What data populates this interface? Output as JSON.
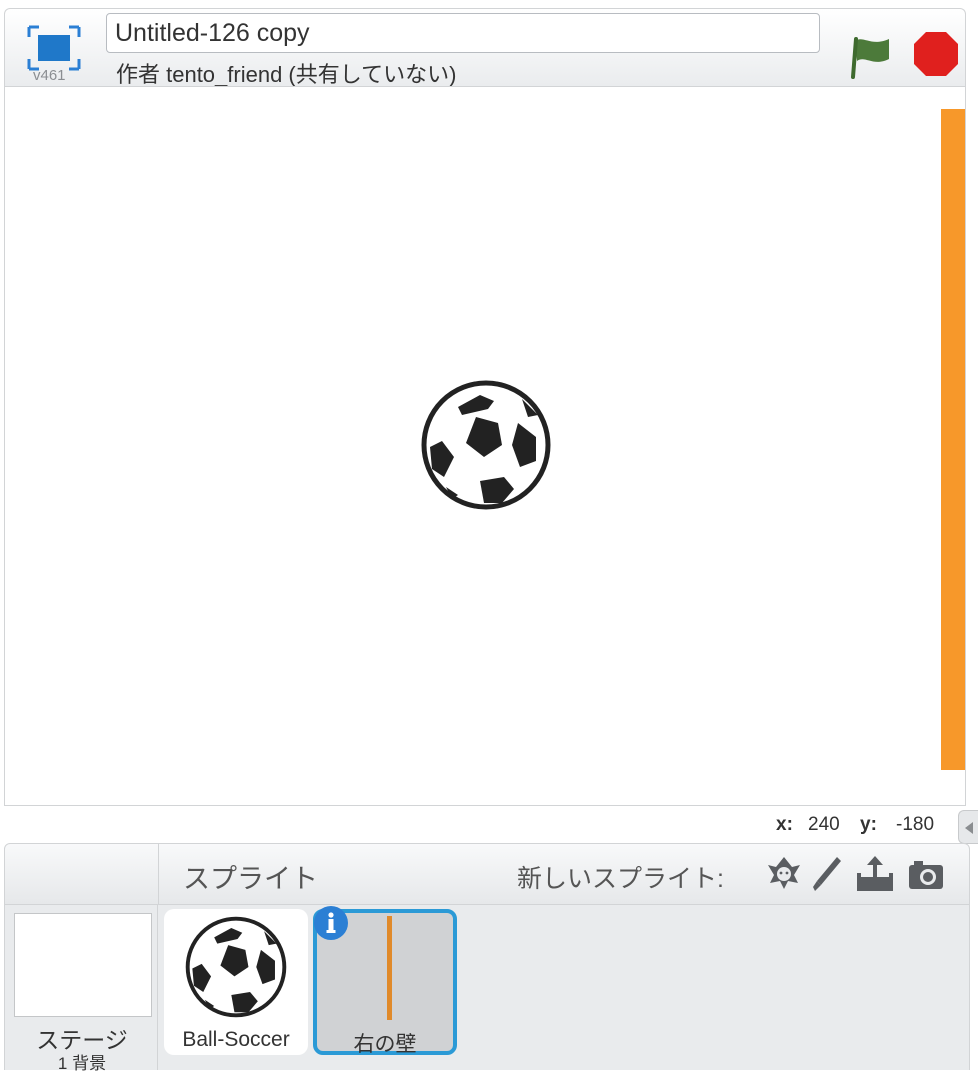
{
  "header": {
    "version": "v461",
    "project_title": "Untitled-126 copy",
    "author_line": "作者 tento_friend (共有していない)"
  },
  "stage": {
    "wall_color": "#f7982a",
    "icons": {
      "fullscreen": "fullscreen-icon",
      "green_flag": "green-flag-icon",
      "stop": "stop-icon"
    }
  },
  "coordinates": {
    "x_label": "x:",
    "x_value": "240",
    "y_label": "y:",
    "y_value": "-180"
  },
  "sprite_pane": {
    "title": "スプライト",
    "new_sprite_label": "新しいスプライト:",
    "tools": [
      "choose-sprite-from-library-icon",
      "paint-new-sprite-icon",
      "upload-sprite-icon",
      "camera-icon"
    ],
    "stage": {
      "label": "ステージ",
      "backdrop_count": "1 背景"
    },
    "sprites": [
      {
        "name": "Ball-Soccer",
        "selected": false
      },
      {
        "name": "右の壁",
        "selected": true
      }
    ]
  },
  "colors": {
    "accent_blue": "#2b9ad6",
    "flag_green": "#4c7a3a",
    "stop_red": "#e0201e",
    "wall_orange": "#f7982a"
  }
}
